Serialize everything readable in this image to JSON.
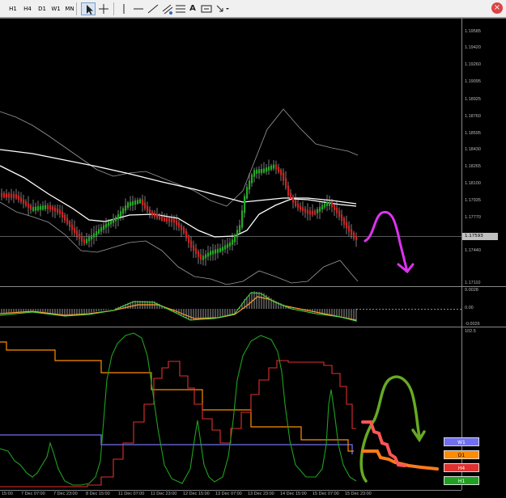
{
  "toolbar": {
    "timeframes": [
      "H1",
      "H4",
      "D1",
      "W1",
      "MN"
    ],
    "tools": {
      "cursor": "cursor-icon",
      "crosshair": "crosshair-icon",
      "vline": "vertical-line-icon",
      "hline": "horizontal-line-icon",
      "trendline": "trendline-icon",
      "channel": "equidistant-channel-icon",
      "fibo": "fibonacci-icon",
      "text": "A",
      "label": "text-label-icon",
      "arrows": "arrows-icon"
    },
    "close": "×"
  },
  "price_axis": {
    "ticks": [
      "1.19585",
      "1.19420",
      "1.19260",
      "1.19095",
      "1.18925",
      "1.18760",
      "1.18595",
      "1.18430",
      "1.18265",
      "1.18100",
      "1.17935",
      "1.17770",
      "1.17440",
      "1.17110"
    ],
    "current_price": "1.17593"
  },
  "macd_axis": {
    "ticks": [
      "0.0028",
      "0.00",
      "-0.0026"
    ]
  },
  "stoch_axis": {
    "ticks": [
      "102.5",
      "-2.50"
    ]
  },
  "time_axis": {
    "ticks": [
      "15:00",
      "7 Dec 07:00",
      "7 Dec 23:00",
      "8 Dec 15:00",
      "11 Dec 07:00",
      "11 Dec 23:00",
      "12 Dec 15:00",
      "13 Dec 07:00",
      "13 Dec 23:00",
      "14 Dec 15:00",
      "15 Dec 07:00",
      "15 Dec 23:00"
    ]
  },
  "legend": [
    {
      "label": "W1",
      "color": "#7070ee"
    },
    {
      "label": "D1",
      "color": "#ff8c00"
    },
    {
      "label": "H4",
      "color": "#e03030"
    },
    {
      "label": "H1",
      "color": "#20a020"
    }
  ],
  "colors": {
    "background": "#000000",
    "bull_candle": "#22aa22",
    "bear_candle": "#cc2222",
    "annotation_magenta": "#dd33ee",
    "annotation_green": "#66aa22",
    "annotation_orange": "#ff7a1a",
    "annotation_red": "#ff5555"
  }
}
